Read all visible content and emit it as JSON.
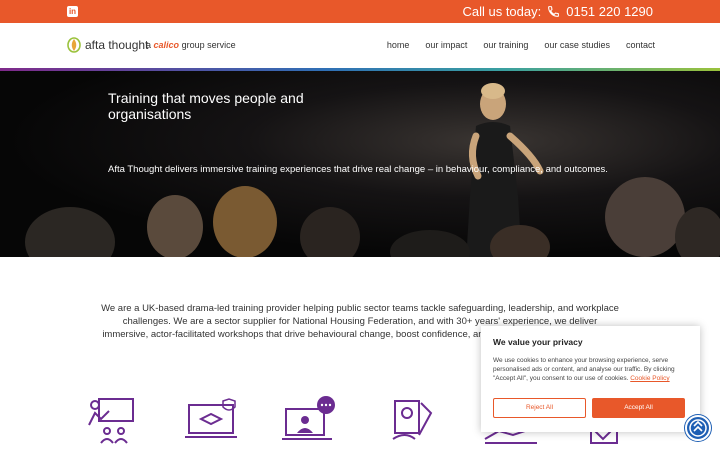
{
  "topbar": {
    "linkedin_icon": "linkedin-icon",
    "call_label": "Call us today:",
    "phone_icon": "phone-icon",
    "phone_number": "0151 220 1290",
    "color": "#e8582a"
  },
  "header": {
    "logo_text": "afta thought",
    "tagline_prefix": "a",
    "tagline_brand": "calico",
    "tagline_suffix": "group service",
    "nav": [
      "home",
      "our impact",
      "our training",
      "our case studies",
      "contact"
    ]
  },
  "hero": {
    "title": "Training that moves people and organisations",
    "description": "Afta Thought delivers immersive training experiences that drive real change – in behaviour, compliance, and outcomes."
  },
  "intro": {
    "text": "We are a UK-based drama-led training provider helping public sector teams tackle safeguarding, leadership, and workplace challenges. We are a sector supplier for National Housing Federation, and with 30+ years' experience, we deliver immersive, actor-facilitated workshops that drive behavioural change, boost confidence, and improve professional practice."
  },
  "icons": [
    "trainer-presentation-icon",
    "online-learning-icon",
    "video-chat-icon",
    "certificate-icon",
    "handshake-icon",
    "checklist-icon"
  ],
  "cookie": {
    "title": "We value your privacy",
    "body": "We use cookies to enhance your browsing experience, serve personalised ads or content, and analyse our traffic. By clicking \"Accept All\", you consent to our use of cookies.",
    "policy_link": "Cookie Policy",
    "reject_label": "Reject All",
    "accept_label": "Accept All"
  },
  "colors": {
    "accent": "#e8582a",
    "icon_purple": "#6b2c91",
    "accessibility_blue": "#1e5fb4"
  }
}
